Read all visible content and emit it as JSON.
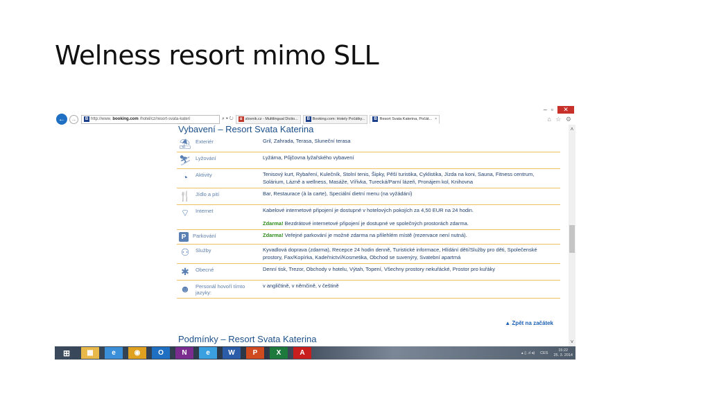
{
  "slide": {
    "title": "Welness resort mimo SLL"
  },
  "browser": {
    "window_controls": {
      "minimize": "–",
      "restore": "▫",
      "close": "✕"
    },
    "address": {
      "prefix": "http://www.",
      "domain": "booking.com",
      "rest": "/hotel/cz/resort-svata-kateri",
      "tools": "⌕ ▾ ↻"
    },
    "tabs": [
      {
        "label": "slovnik.cz - Multilingual Dictio...",
        "icon": "slovnik-icon",
        "color": "#c0392b",
        "letter": "α"
      },
      {
        "label": "Booking.com: Hotely Počátky...",
        "icon": "booking-icon",
        "color": "#1c3f8c",
        "letter": "B"
      },
      {
        "label": "Resort Svata Katerina, Počát...",
        "icon": "booking-icon",
        "color": "#1c3f8c",
        "letter": "B",
        "active": true
      }
    ],
    "right_tools": "⌂ ☆ ⚙"
  },
  "page": {
    "section_title": "Vybavení – Resort Svata Katerina",
    "facilities": [
      {
        "icon": "umbrella-icon",
        "glyph": "⛱",
        "label": "Exteriér",
        "lines": [
          {
            "free": "",
            "text": "Gril, Zahrada, Terasa, Sluneční terasa"
          }
        ]
      },
      {
        "icon": "skier-icon",
        "glyph": "⛷",
        "label": "Lyžování",
        "lines": [
          {
            "free": "",
            "text": "Lyžárna, Půjčovna lyžařského vybavení"
          }
        ]
      },
      {
        "icon": "sport-icon",
        "glyph": "◔",
        "label": "Aktivity",
        "lines": [
          {
            "free": "",
            "text": "Tenisový kurt, Rybaření, Kulečník, Stolní tenis, Šipky, Pěší turistika, Cyklistika, Jízda na koni, Sauna, Fitness centrum, Solárium, Lázně a wellness, Masáže, Vířivka, Turecká/Parní lázeň, Pronájem kol, Knihovna"
          }
        ]
      },
      {
        "icon": "food-icon",
        "glyph": "🍴",
        "label": "Jídlo a pití",
        "lines": [
          {
            "free": "",
            "text": "Bar, Restaurace (à la carte), Speciální dietní menu (na vyžádání)"
          }
        ]
      },
      {
        "icon": "wifi-icon",
        "glyph": "⌔",
        "label": "Internet",
        "lines": [
          {
            "free": "",
            "text": "Kabelové internetové připojení je dostupné v hotelových pokojích za 4,50 EUR na 24 hodin."
          },
          {
            "free": "Zdarma!",
            "text": " Bezdrátové internetové připojení je dostupné ve společných prostorách zdarma."
          }
        ]
      },
      {
        "icon": "parking-icon",
        "glyph": "P",
        "label": "Parkování",
        "lines": [
          {
            "free": "Zdarma!",
            "text": " Veřejné parkování je možné zdarma na přilehlém místě (rezervace není nutná)."
          }
        ]
      },
      {
        "icon": "services-icon",
        "glyph": "⚇",
        "label": "Služby",
        "lines": [
          {
            "free": "",
            "text": "Kyvadlová doprava (zdarma), Recepce 24 hodin denně, Turistické informace, Hlídání dětí/Služby pro děti, Společenské prostory, Fax/Kopírka, Kadeřnictví/Kosmetika, Obchod se suvenýry, Svatební apartmá"
          }
        ]
      },
      {
        "icon": "general-icon",
        "glyph": "✱",
        "label": "Obecné",
        "lines": [
          {
            "free": "",
            "text": "Denní tisk, Trezor, Obchody v hotelu, Výtah, Topení, Všechny prostory nekuřácké, Prostor pro kuřáky"
          }
        ]
      },
      {
        "icon": "speech-icon",
        "glyph": "☻",
        "label": "Personál hovoří tímto jazyky:",
        "lines": [
          {
            "free": "",
            "text": "v angličtině, v němčině, v češtině"
          }
        ]
      }
    ],
    "back_to_top": "▲ Zpět na začátek",
    "next_section_title": "Podmínky – Resort Svata Katerina"
  },
  "taskbar": {
    "apps": [
      {
        "name": "explorer-icon",
        "glyph": "▦",
        "color": "#e8b84a"
      },
      {
        "name": "ie-icon",
        "glyph": "e",
        "color": "#3a8fd8"
      },
      {
        "name": "chrome-icon",
        "glyph": "◉",
        "color": "#e0a020"
      },
      {
        "name": "outlook-icon",
        "glyph": "O",
        "color": "#1f6fc2"
      },
      {
        "name": "onenote-icon",
        "glyph": "N",
        "color": "#7b2c8f"
      },
      {
        "name": "ie-icon",
        "glyph": "e",
        "color": "#3aa0e0"
      },
      {
        "name": "word-icon",
        "glyph": "W",
        "color": "#2a5ca8"
      },
      {
        "name": "powerpoint-icon",
        "glyph": "P",
        "color": "#d04a1f"
      },
      {
        "name": "excel-icon",
        "glyph": "X",
        "color": "#1e7a3c"
      },
      {
        "name": "acrobat-icon",
        "glyph": "A",
        "color": "#c81e1e"
      }
    ],
    "tray": {
      "indicators": "▴  ▯ .ıl ◂)",
      "lang": "CES",
      "time": "15:22",
      "date": "25. 3. 2014"
    }
  }
}
